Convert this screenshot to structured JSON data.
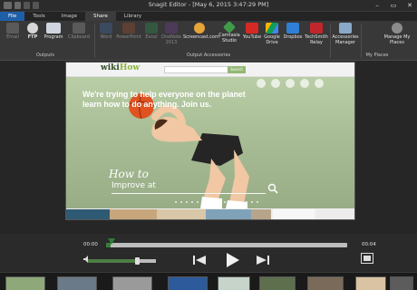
{
  "window": {
    "title": "Snagit Editor - [May 6, 2015 3:47:29 PM]"
  },
  "tabs": [
    {
      "label": "File"
    },
    {
      "label": "Tools"
    },
    {
      "label": "Image"
    },
    {
      "label": "Share"
    },
    {
      "label": "Library"
    }
  ],
  "active_tab": "Share",
  "ribbon": {
    "outputs": {
      "label": "Outputs",
      "buttons": [
        {
          "label": "Email",
          "enabled": false
        },
        {
          "label": "FTP",
          "enabled": true
        },
        {
          "label": "Program",
          "enabled": true
        },
        {
          "label": "Clipboard",
          "enabled": false
        }
      ]
    },
    "accessories": {
      "label": "Output Accessories",
      "buttons": [
        {
          "label": "Word",
          "enabled": false
        },
        {
          "label": "PowerPoint",
          "enabled": false
        },
        {
          "label": "Excel",
          "enabled": false
        },
        {
          "label": "OneNote 2013",
          "enabled": false
        },
        {
          "label": "Screencast.com",
          "enabled": true
        },
        {
          "label": "Camtasia Studio",
          "enabled": true
        },
        {
          "label": "YouTube",
          "enabled": true
        },
        {
          "label": "Google Drive",
          "enabled": true
        },
        {
          "label": "Dropbox",
          "enabled": true
        },
        {
          "label": "TechSmith Relay",
          "enabled": true
        },
        {
          "label": "Accessories Manager",
          "enabled": true
        }
      ]
    },
    "places": {
      "label": "My Places",
      "buttons": [
        {
          "label": "Manage My Places",
          "enabled": true
        }
      ]
    }
  },
  "capture": {
    "site_logo_a": "wiki",
    "site_logo_b": "How",
    "search_button": "Search",
    "hero_line1": "We're trying to help everyone on the planet",
    "hero_line2": "learn how to do anything. Join us.",
    "hero_how": "How to",
    "hero_improve": "Improve at"
  },
  "player": {
    "time_current": "00:00",
    "time_total": "00:04",
    "progress": 0.0,
    "volume": 0.7
  },
  "colors": {
    "accent_file_tab": "#1f5fa8",
    "progress_green": "#3a7c3a",
    "hero_green": "#a8bd95"
  }
}
